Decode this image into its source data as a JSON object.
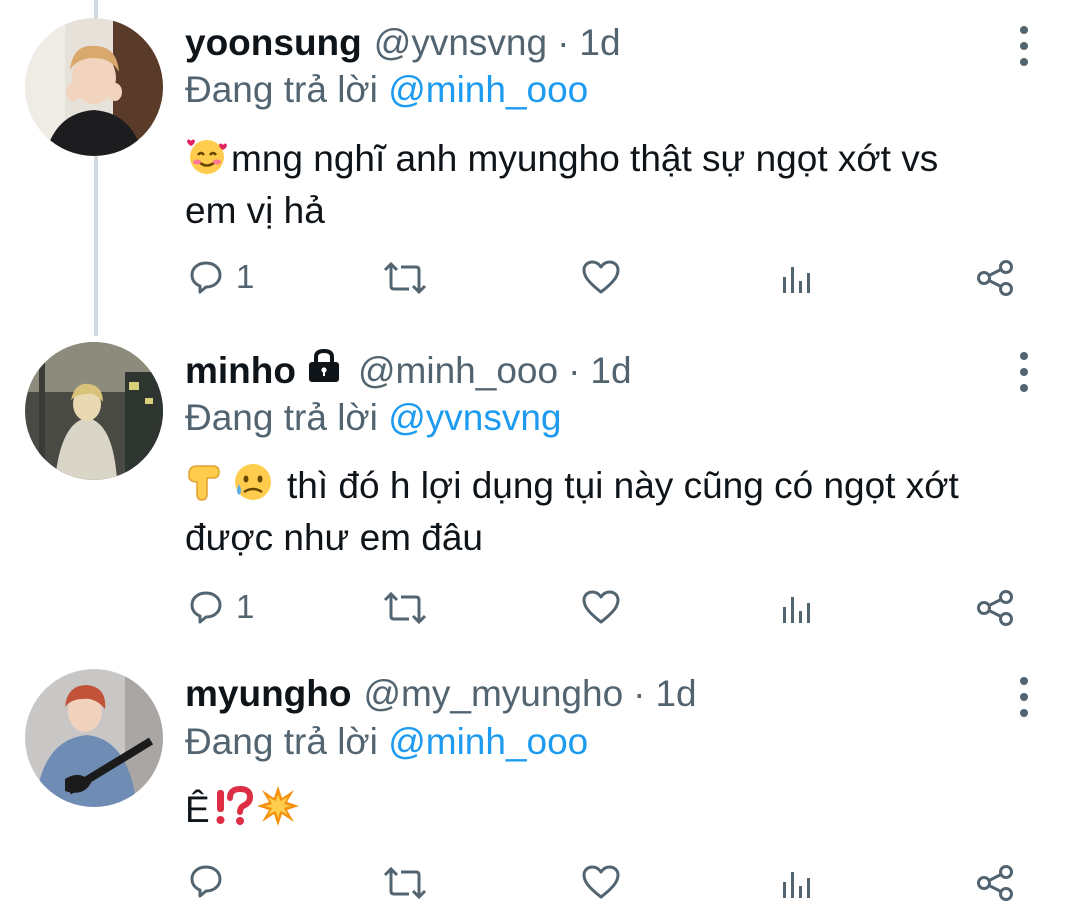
{
  "tweets": [
    {
      "name": "yoonsung",
      "handle": "@yvnsvng",
      "time": "1d",
      "reply_prefix": "Đang trả lời ",
      "reply_mention": "@minh_ooo",
      "text_line1": "mng nghĩ anh myungho thật sự ngọt xớt vs",
      "text_line2": "em vị hả",
      "emojis": [
        "smiling-face-with-hearts"
      ],
      "reply_count": "1",
      "locked": false
    },
    {
      "name": "minho",
      "handle": "@minh_ooo",
      "time": "1d",
      "reply_prefix": "Đang trả lời ",
      "reply_mention": "@yvnsvng",
      "text_line1": "thì đó h lợi dụng tụi này cũng có ngọt xớt",
      "text_line2": "được như em đâu",
      "emojis": [
        "backhand-index-pointing-down",
        "sad-but-relieved-face"
      ],
      "reply_count": "1",
      "locked": true
    },
    {
      "name": "myungho",
      "handle": "@my_myungho",
      "time": "1d",
      "reply_prefix": "Đang trả lời ",
      "reply_mention": "@minh_ooo",
      "text_line1": "Ê",
      "text_line2": "",
      "emojis": [
        "exclamation-question-mark",
        "collision"
      ],
      "reply_count": "",
      "locked": false
    }
  ],
  "separator": "·",
  "colors": {
    "text": "#0f1419",
    "secondary": "#536471",
    "link": "#1d9bf0",
    "thread_line": "#cfd9de"
  }
}
